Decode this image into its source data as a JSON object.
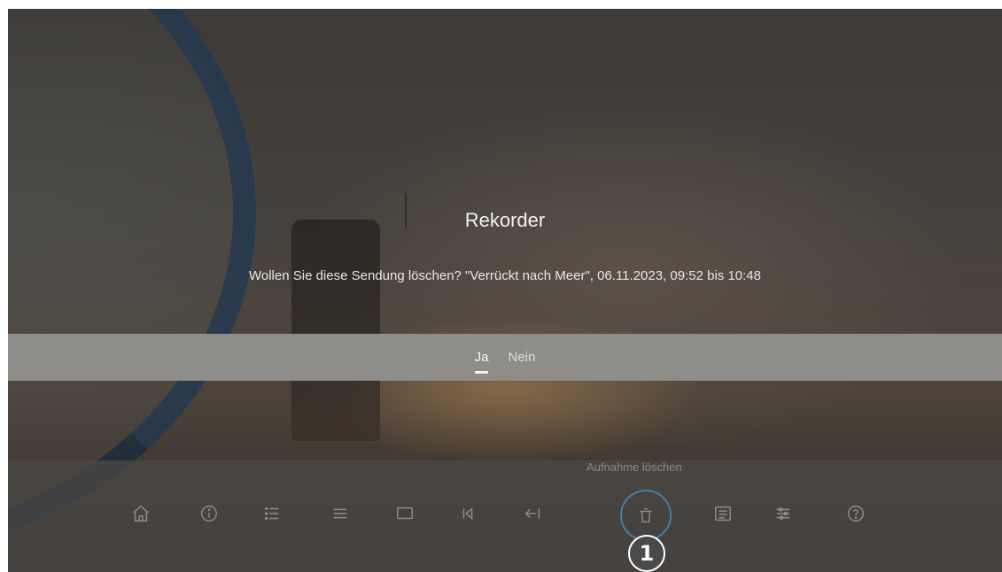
{
  "dialog": {
    "title": "Rekorder",
    "message": "Wollen Sie diese Sendung löschen? \"Verrückt nach Meer\", 06.11.2023, 09:52 bis 10:48",
    "buttons": {
      "yes": "Ja",
      "no": "Nein"
    },
    "selected": "Ja"
  },
  "toolbar": {
    "tooltip": "Aufnahme löschen",
    "items": [
      {
        "icon": "home-icon"
      },
      {
        "icon": "info-icon"
      },
      {
        "icon": "list-icon"
      },
      {
        "icon": "menu-icon"
      },
      {
        "icon": "screen-icon"
      },
      {
        "icon": "skip-back-icon"
      },
      {
        "icon": "back-arrow-icon"
      },
      {
        "icon": "trash-icon",
        "active": true
      },
      {
        "icon": "guide-icon"
      },
      {
        "icon": "settings-sliders-icon"
      },
      {
        "icon": "help-icon"
      }
    ]
  },
  "annotation": {
    "badge": "1"
  },
  "colors": {
    "accent_ring": "#4a7ea6",
    "button_bar": "#8f8d8a"
  }
}
